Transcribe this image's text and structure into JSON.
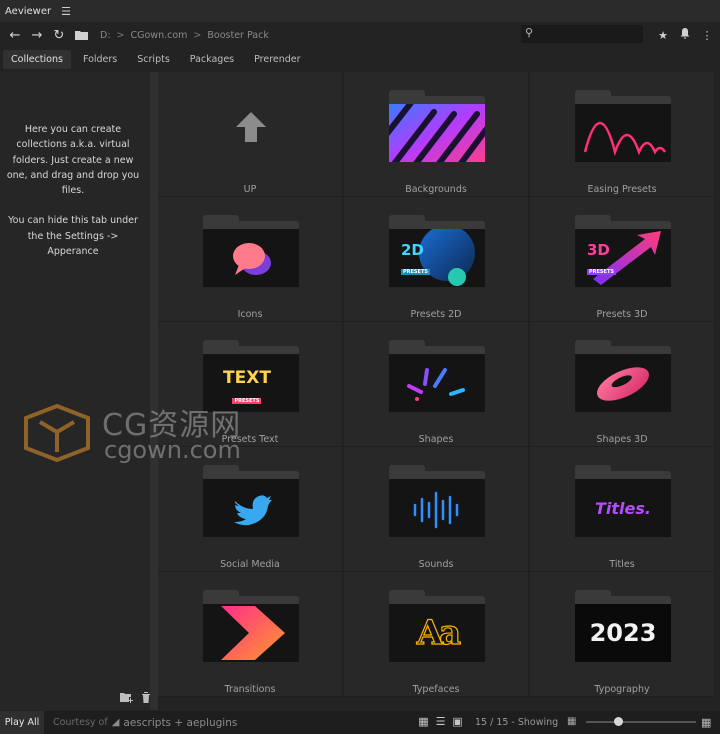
{
  "app": {
    "title": "Aeviewer",
    "menu_icon": "hamburger-icon"
  },
  "nav": {
    "breadcrumbs": [
      "D:",
      "CGown.com",
      "Booster Pack"
    ],
    "search": {
      "placeholder": "",
      "value": ""
    }
  },
  "tabs": [
    {
      "label": "Collections",
      "active": true
    },
    {
      "label": "Folders",
      "active": false
    },
    {
      "label": "Scripts",
      "active": false
    },
    {
      "label": "Packages",
      "active": false
    },
    {
      "label": "Prerender",
      "active": false
    }
  ],
  "sidebar": {
    "help_paragraphs": [
      "Here you can create collections a.k.a. virtual folders. Just create a new one, and drag and drop you files.",
      "You can hide this tab under the the Settings -> Apperance"
    ]
  },
  "grid": {
    "items": [
      {
        "label": "UP",
        "thumb": "up-arrow"
      },
      {
        "label": "Backgrounds",
        "thumb": "diagonal-stripes"
      },
      {
        "label": "Easing Presets",
        "thumb": "bounce-arcs"
      },
      {
        "label": "Icons",
        "thumb": "chat-bubbles"
      },
      {
        "label": "Presets 2D",
        "thumb": "presets-2d",
        "badge": "2D",
        "sub": "PRESETS"
      },
      {
        "label": "Presets 3D",
        "thumb": "presets-3d",
        "badge": "3D",
        "sub": "PRESETS"
      },
      {
        "label": "Presets Text",
        "thumb": "text-presets",
        "badge": "TEXT",
        "sub": "PRESETS"
      },
      {
        "label": "Shapes",
        "thumb": "burst-lines"
      },
      {
        "label": "Shapes 3D",
        "thumb": "torus"
      },
      {
        "label": "Social Media",
        "thumb": "bird"
      },
      {
        "label": "Sounds",
        "thumb": "waveform"
      },
      {
        "label": "Titles",
        "thumb": "titles",
        "badge": "Titles."
      },
      {
        "label": "Transitions",
        "thumb": "chevron"
      },
      {
        "label": "Typefaces",
        "thumb": "typeface",
        "badge": "Aa"
      },
      {
        "label": "Typography",
        "thumb": "typography",
        "badge": "2023"
      }
    ]
  },
  "watermark": {
    "line1": "CG资源网",
    "line2": "cgown.com"
  },
  "status": {
    "play_all": "Play All",
    "courtesy": "Courtesy of",
    "brand": "aescripts + aeplugins",
    "showing": "15 / 15 - Showing",
    "zoom_level": 0.3
  },
  "colors": {
    "accent_pink": "#ff3d8b",
    "accent_purple": "#8f3dff",
    "accent_cyan": "#31d1ff"
  }
}
